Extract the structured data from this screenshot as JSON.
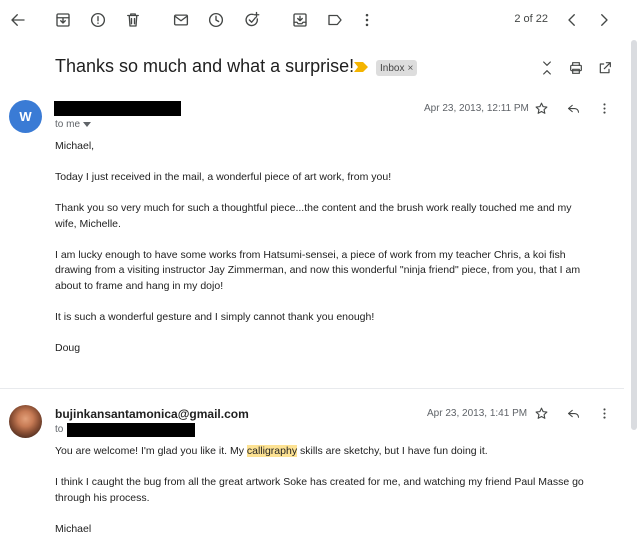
{
  "toolbar": {
    "icons": [
      "back-arrow-icon",
      "archive-icon",
      "report-spam-icon",
      "delete-icon",
      "mark-unread-icon",
      "snooze-icon",
      "add-task-icon",
      "move-to-icon",
      "label-icon",
      "more-vert-icon",
      "prev-icon",
      "next-icon"
    ],
    "pager": "2 of 22"
  },
  "thread": {
    "subject": "Thanks so much and what a surprise!",
    "label": "Inbox",
    "label_remove": "×",
    "colors": {
      "important_marker": "#f4b400",
      "link_blue": "#1a73e8"
    }
  },
  "message1": {
    "avatar_letter": "W",
    "avatar_color": "#3a7bd5",
    "to": "to me",
    "date": "Apr 23, 2013, 12:11 PM",
    "paragraphs": [
      "Michael,",
      "Today I just received in the mail, a wonderful piece of art work, from you!",
      "Thank you so very much for such a thoughtful piece...the content and the brush work really touched me and my wife, Michelle.",
      "I am lucky enough to have some works from Hatsumi-sensei, a piece of work from my teacher Chris, a koi fish drawing from a visiting instructor Jay Zimmerman, and now this wonderful \"ninja friend\" piece, from you, that I am about to frame and hang in my dojo!",
      "It is such a wonderful gesture and I simply cannot thank you enough!",
      "Doug"
    ]
  },
  "message2": {
    "sender": "bujinkansantamonica@gmail.com",
    "to": "to",
    "date": "Apr 23, 2013, 1:41 PM",
    "p1_before": "You are welcome! I'm glad you like it. My ",
    "p1_highlight": "calligraphy",
    "p1_after": " skills are sketchy, but I have fun doing it.",
    "p2": "I think I caught the bug from all the great artwork Soke has created for me, and watching my friend Paul Masse go through his process.",
    "p3": "Michael"
  }
}
